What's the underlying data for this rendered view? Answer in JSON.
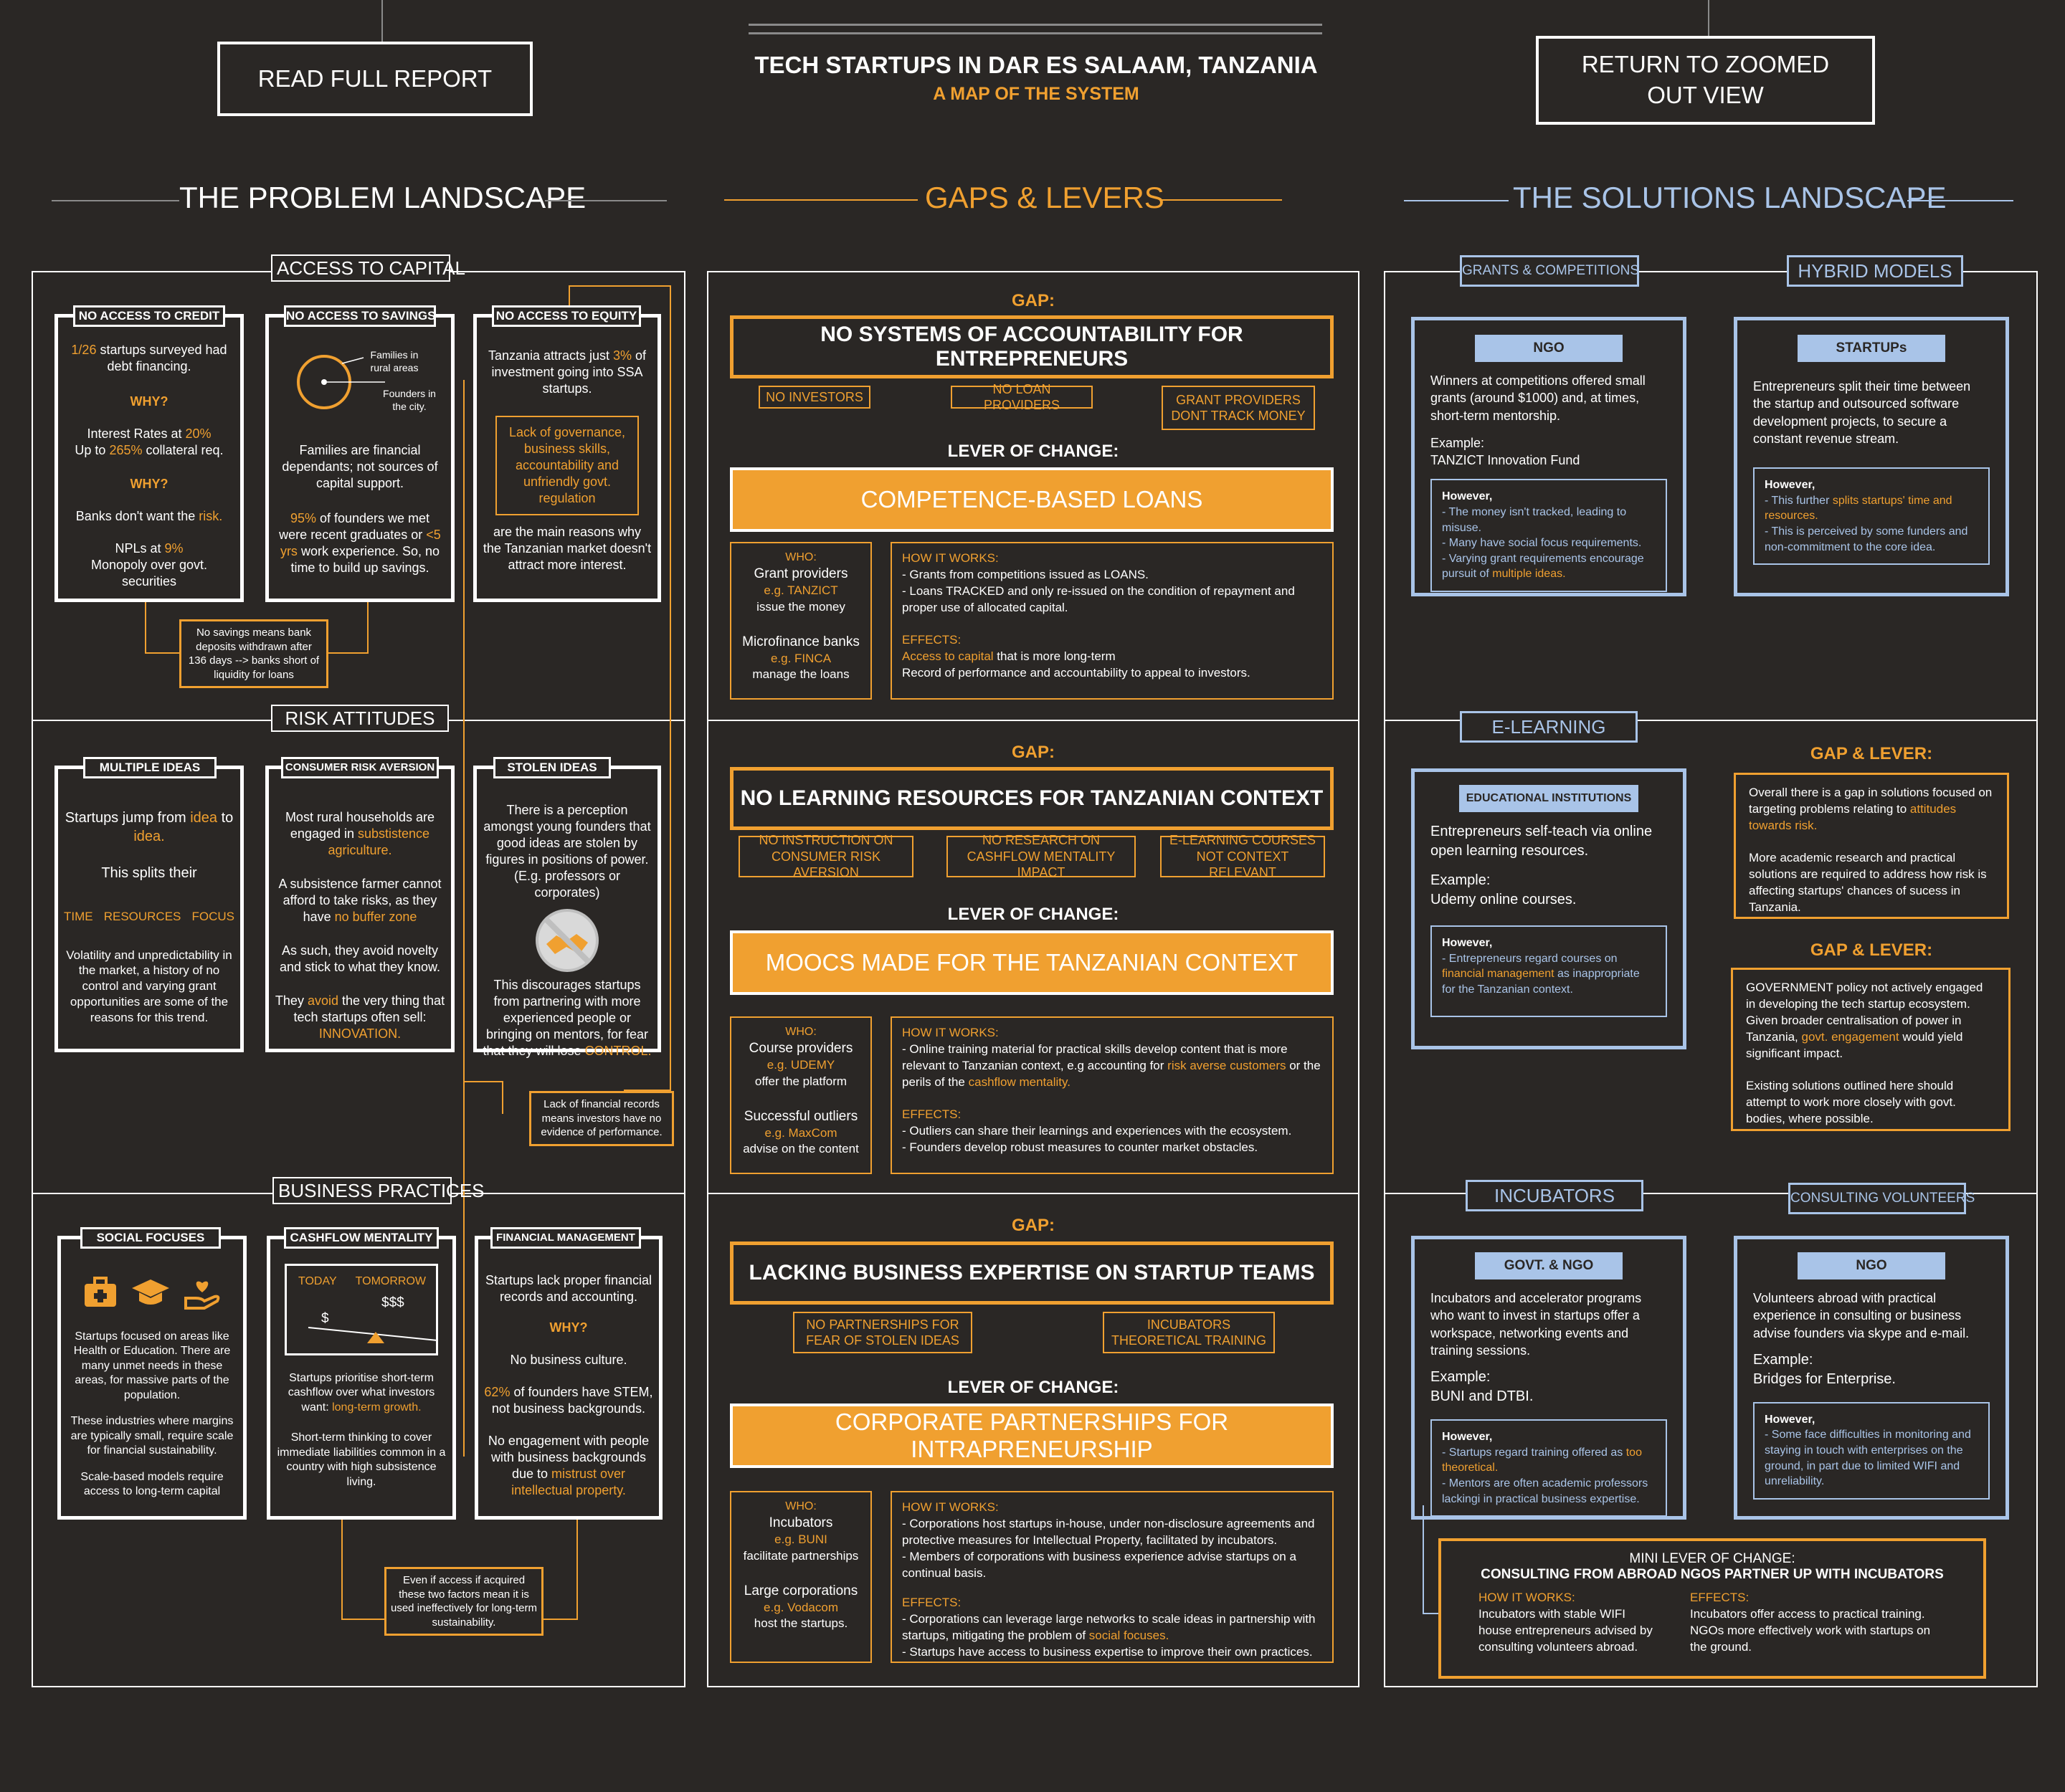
{
  "header": {
    "read_full_report": "READ FULL REPORT",
    "title": "TECH STARTUPS IN DAR ES SALAAM, TANZANIA",
    "subtitle": "A MAP OF THE SYSTEM",
    "return_button": "RETURN TO ZOOMED OUT VIEW"
  },
  "sections": {
    "problem": "THE PROBLEM LANDSCAPE",
    "gaps": "GAPS & LEVERS",
    "solutions": "THE SOLUTIONS LANDSCAPE"
  },
  "colors": {
    "background": "#2a2725",
    "accent_orange": "#f0a030",
    "accent_blue": "#a9c4e8",
    "text": "#ffffff"
  },
  "problem": {
    "capital": {
      "title": "ACCESS TO CAPITAL",
      "credit": {
        "tag": "NO ACCESS TO CREDIT",
        "hl1": "1/26",
        "t1": " startups surveyed had debt financing.",
        "why1": "WHY?",
        "t2a": "Interest Rates at ",
        "hl2": "20%",
        "t2b": "Up to ",
        "hl3": "265%",
        "t2c": " collateral req.",
        "why2": "WHY?",
        "t3": "Banks don't want the ",
        "hl4": "risk.",
        "t4": "NPLs at ",
        "hl5": "9%",
        "t5": "Monopoly over govt. securities"
      },
      "savings": {
        "tag": "NO ACCESS TO SAVINGS",
        "lbl_families": "Families in rural areas",
        "lbl_founders": "Founders in the city.",
        "t1": "Families are financial dependants; not sources of capital support.",
        "hl1": "95%",
        "t2": " of founders we met were recent graduates or ",
        "hl2": "<5 yrs",
        "t3": " work experience. So, no time to build up savings."
      },
      "equity": {
        "tag": "NO ACCESS TO EQUITY",
        "t1": "Tanzania attracts just ",
        "hl1": "3%",
        "t2": " of investment going into SSA startups.",
        "box": "Lack of governance, business skills, accountability and unfriendly govt. regulation",
        "t3": "are the main reasons why the Tanzanian market doesn't attract more interest."
      },
      "note": "No savings means bank deposits withdrawn after 136 days --> banks short of liquidity for loans"
    },
    "risk": {
      "title": "RISK ATTITUDES",
      "multiple": {
        "tag": "MULTIPLE IDEAS",
        "t1": "Startups jump from ",
        "hl1": "idea",
        "t2": " to ",
        "hl2": "idea.",
        "t3": "This splits their",
        "w1": "TIME",
        "w2": "RESOURCES",
        "w3": "FOCUS",
        "t4": "Volatility and unpredictability in the market, a history of no control and varying grant opportunities are some of the reasons for this trend."
      },
      "consumer": {
        "tag": "CONSUMER RISK AVERSION",
        "t1": "Most rural households are engaged in ",
        "hl1": "substistence agriculture.",
        "t2": "A subsistence farmer cannot afford to take risks, as they have ",
        "hl2": "no buffer zone",
        "t3": "As such, they avoid novelty and stick to what they know.",
        "t4": "They ",
        "hl3": "avoid",
        "t5": " the very thing that tech startups often sell: ",
        "hl4": "INNOVATION."
      },
      "stolen": {
        "tag": "STOLEN IDEAS",
        "t1": "There is a perception amongst young founders that good ideas are stolen by figures in positions of power. (E.g. professors or corporates)",
        "t2": "This discourages startups from partnering with more experienced people or bringing on mentors, for fear that they will lose ",
        "hl1": "CONTROL."
      },
      "note": "Lack of financial records means investors have no evidence of performance."
    },
    "business": {
      "title": "BUSINESS PRACTICES",
      "social": {
        "tag": "SOCIAL FOCUSES",
        "t1": "Startups focused on areas like Health or Education. There are many unmet needs in these areas, for massive parts of the population.",
        "t2": "These industries where margins are typically small, require scale for financial sustainability.",
        "t3": "Scale-based models require access to long-term capital"
      },
      "cashflow": {
        "tag": "CASHFLOW MENTALITY",
        "today": "TODAY",
        "tomorrow": "TOMORROW",
        "dollar": "$",
        "dollars": "$$$",
        "t1": "Startups prioritise short-term cashflow over what investors want: ",
        "hl1": "long-term growth.",
        "t2": "Short-term thinking to cover immediate liabilities common in a country with high subsistence living."
      },
      "financial": {
        "tag": "FINANCIAL MANAGEMENT",
        "t1": "Startups lack proper financial records and accounting.",
        "why": "WHY?",
        "t2": "No business culture.",
        "hl1": "62%",
        "t3": " of founders have STEM, not business backgrounds.",
        "t4": "No engagement with people with business backgrounds due to ",
        "hl2": "mistrust over intellectual property."
      },
      "note": "Even if access if acquired these two factors mean it is used ineffectively for long-term sustainability."
    }
  },
  "gaps": [
    {
      "gap_label": "GAP:",
      "gap": "NO SYSTEMS OF ACCOUNTABILITY FOR ENTREPRENEURS",
      "chips": [
        "NO INVESTORS",
        "NO LOAN PROVIDERS",
        "GRANT PROVIDERS DONT TRACK MONEY"
      ],
      "lever_label": "LEVER OF CHANGE:",
      "lever": "COMPETENCE-BASED LOANS",
      "who": {
        "label": "WHO:",
        "a": "Grant providers",
        "a_eg": "e.g. TANZICT",
        "a_do": "issue the money",
        "b": "Microfinance banks",
        "b_eg": "e.g. FINCA",
        "b_do": "manage the loans"
      },
      "how_label": "HOW IT WORKS:",
      "how": [
        "- Grants from competitions  issued as LOANS.",
        "- Loans TRACKED and only re-issued on the condition of repayment and proper use of allocated capital."
      ],
      "eff_label": "EFFECTS:",
      "eff_hl": "Access to capital",
      "eff1": " that is more  long-term",
      "eff2": "Record of performance and accountability to appeal to investors."
    },
    {
      "gap_label": "GAP:",
      "gap": "NO LEARNING RESOURCES FOR TANZANIAN CONTEXT",
      "chips": [
        "NO INSTRUCTION ON CONSUMER RISK AVERSION",
        "NO RESEARCH ON CASHFLOW MENTALITY IMPACT",
        "E-LEARNING COURSES NOT CONTEXT RELEVANT"
      ],
      "lever_label": "LEVER OF CHANGE:",
      "lever": "MOOCS MADE FOR THE TANZANIAN CONTEXT",
      "who": {
        "label": "WHO:",
        "a": "Course providers",
        "a_eg": "e.g. UDEMY",
        "a_do": "offer the platform",
        "b": "Successful outliers",
        "b_eg": "e.g. MaxCom",
        "b_do": "advise on the content"
      },
      "how_label": "HOW IT WORKS:",
      "how1": "- Online training material for practical skills develop content that is more relevant to Tanzanian context, e.g accounting for ",
      "how_hl1": "risk averse customers",
      "how2": " or the perils of the ",
      "how_hl2": "cashflow mentality.",
      "eff_label": "EFFECTS:",
      "eff": [
        "- Outliers can share their learnings and experiences with the ecosystem.",
        "- Founders develop robust measures to counter market obstacles."
      ]
    },
    {
      "gap_label": "GAP:",
      "gap": "LACKING BUSINESS EXPERTISE ON STARTUP TEAMS",
      "chips": [
        "NO PARTNERSHIPS FOR FEAR OF STOLEN IDEAS",
        "INCUBATORS THEORETICAL TRAINING"
      ],
      "lever_label": "LEVER OF CHANGE:",
      "lever": "CORPORATE PARTNERSHIPS FOR INTRAPRENEURSHIP",
      "who": {
        "label": "WHO:",
        "a": "Incubators",
        "a_eg": "e.g. BUNI",
        "a_do": "facilitate partnerships",
        "b": "Large corporations",
        "b_eg": "e.g. Vodacom",
        "b_do": "host the startups."
      },
      "how_label": "HOW IT WORKS:",
      "how": [
        "- Corporations host startups in-house, under non-disclosure agreements and protective measures for Intellectual Property, facilitated by incubators.",
        "- Members of corporations with business experience advise startups on a continual basis."
      ],
      "eff_label": "EFFECTS:",
      "eff1": "- Corporations can leverage large networks to scale ideas in partnership with startups, mitigating the problem of ",
      "eff_hl": "social focuses.",
      "eff2": "- Startups have access to business expertise to improve their own practices."
    }
  ],
  "solutions": {
    "grants": {
      "tag": "GRANTS & COMPETITIONS",
      "head": "NGO",
      "t1": "Winners at competitions offered small grants (around $1000) and, at times, short-term mentorship.",
      "ex": "Example:",
      "ex_v": "TANZICT Innovation Fund",
      "however": "However,",
      "h1": "- The money isn't tracked, leading to misuse.",
      "h2": "- Many have social focus requirements.",
      "h3": "- Varying grant requirements encourage pursuit of ",
      "h3_hl": "multiple ideas."
    },
    "hybrid": {
      "tag": "HYBRID MODELS",
      "head": "STARTUPs",
      "t1": "Entrepreneurs split their time between the startup and outsourced software development projects, to secure a constant revenue stream.",
      "however": "However,",
      "h1": "- This further ",
      "h1_hl": "splits startups' time and resources.",
      "h2": "- This is perceived by some funders and non-commitment to the core idea."
    },
    "elearning": {
      "tag": "E-LEARNING",
      "head": "EDUCATIONAL INSTITUTIONS",
      "t1": "Entrepreneurs self-teach via online open learning resources.",
      "ex": "Example:",
      "ex_v": "Udemy online courses.",
      "however": "However,",
      "h1": "- Entrepreneurs regard courses on ",
      "h1_hl": "financial management",
      "h2": " as inappropriate for the Tanzanian context."
    },
    "gl1": {
      "title": "GAP & LEVER:",
      "t1": "Overall there is a gap in solutions focused on targeting problems relating  to ",
      "hl1": "attitudes towards risk.",
      "t2": "More academic research and practical solutions are required to address how risk is affecting startups' chances of sucess in Tanzania."
    },
    "gl2": {
      "title": "GAP & LEVER:",
      "t1": "GOVERNMENT policy not  actively engaged in developing the tech startup ecosystem. Given broader centralisation of power in Tanzania, ",
      "hl1": "govt.  engagement",
      "t2": " would yield significant impact.",
      "t3": "Existing solutions outlined here should attempt to work more closely with govt. bodies, where possible."
    },
    "incubators": {
      "tag": "INCUBATORS",
      "head": "GOVT. & NGO",
      "t1": "Incubators and accelerator programs who want to invest in startups offer a workspace, networking events and training sessions.",
      "ex": "Example:",
      "ex_v": "BUNI and DTBI.",
      "however": "However,",
      "h1": "-  Startups regard training offered as ",
      "h1_hl": "too theoretical.",
      "h2": "- Mentors are often academic professors lackingi in practical business expertise."
    },
    "consulting": {
      "tag": "CONSULTING VOLUNTEERS",
      "head": "NGO",
      "t1": "Volunteers abroad with practical experience in consulting or business advise founders via skype and e-mail.",
      "ex": "Example:",
      "ex_v": "Bridges for Enterprise.",
      "however": "However,",
      "h1": "- Some face difficulties in monitoring and staying in touch with enterprises on the ground, in part due to limited WIFI and unreliability."
    },
    "mini": {
      "t1": "MINI LEVER OF CHANGE:",
      "t2": "CONSULTING FROM ABROAD NGOS PARTNER UP WITH INCUBATORS",
      "how_label": "HOW IT WORKS:",
      "how": "Incubators with stable WIFI house entrepreneurs advised by consulting volunteers abroad.",
      "eff_label": "EFFECTS:",
      "eff": "Incubators offer access to practical training. NGOs more effectively work with startups on the ground."
    }
  }
}
